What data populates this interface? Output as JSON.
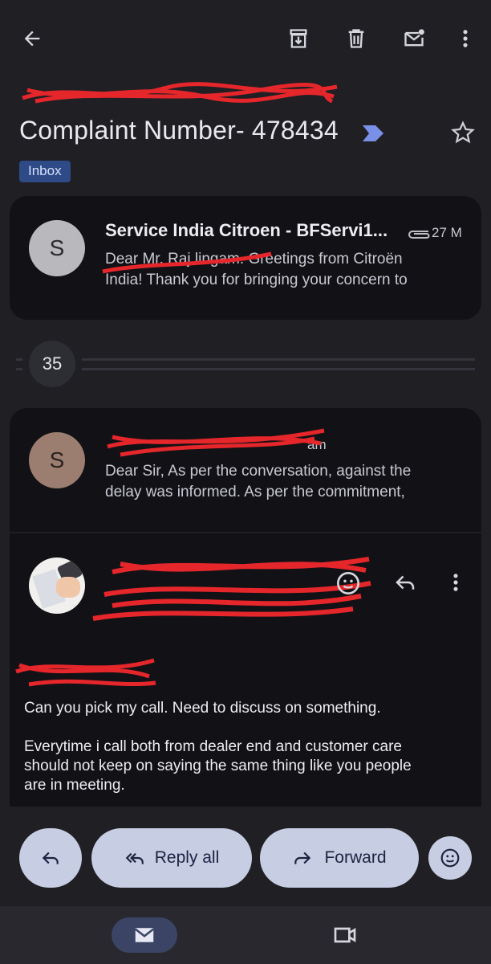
{
  "toolbar": {
    "back_icon": "arrow-back-icon",
    "archive_icon": "archive-icon",
    "delete_icon": "trash-icon",
    "unread_icon": "mark-unread-icon",
    "more_icon": "more-vert-icon"
  },
  "subject": {
    "title": "Complaint Number- 478434",
    "label": "Inbox",
    "important_icon": "important-marker-icon",
    "star_icon": "star-outline-icon"
  },
  "messages": [
    {
      "avatar_letter": "S",
      "sender": "Service India Citroen - BFServi1...",
      "time": "27 M",
      "snippet_line1": "Dear Mr. Raj lingam. Greetings from Citroën",
      "snippet_line2": "India! Thank you for bringing your concern to",
      "attachment_icon": "paperclip-icon"
    },
    {
      "avatar_letter": "S",
      "sender": "",
      "time": "am",
      "snippet_line1": "Dear Sir, As per the conversation, against the",
      "snippet_line2": "delay was informed. As per the commitment,"
    }
  ],
  "collapsed": {
    "count": "35"
  },
  "expanded": {
    "greeting": "",
    "body_line1": "Can you pick my call. Need to discuss on something.",
    "body_line2": "Everytime i call both from dealer end and customer care",
    "body_line3": "should not keep on saying the same thing like you people",
    "body_line4": "are in meeting.",
    "emoji_icon": "emoji-react-icon",
    "reply_icon": "reply-icon",
    "more_icon": "more-vert-icon"
  },
  "actions": {
    "reply_icon": "reply-icon",
    "reply_all_label": "Reply all",
    "forward_label": "Forward",
    "emoji_icon": "emoji-react-icon"
  },
  "nav": {
    "mail_icon": "mail-icon",
    "meet_icon": "video-camera-icon"
  },
  "colors": {
    "background": "#1f1f24",
    "card": "#121216",
    "accent_chip": "#2e4a87",
    "action_button": "#c7cde3",
    "redaction": "#e5262b"
  }
}
